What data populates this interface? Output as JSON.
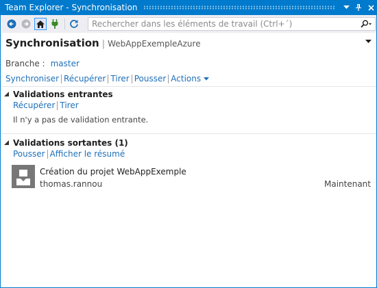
{
  "window": {
    "title": "Team Explorer - Synchronisation",
    "colors": {
      "accent": "#007acc",
      "link": "#1e6fb8",
      "toolbar": "#eeeef2",
      "avatar": "#777777"
    }
  },
  "toolbar": {
    "back_icon": "back-arrow-icon",
    "forward_icon": "forward-arrow-icon",
    "home_icon": "home-icon",
    "connect_icon": "plug-icon",
    "refresh_icon": "refresh-icon",
    "search": {
      "placeholder": "Rechercher dans les éléments de travail (Ctrl+´)"
    }
  },
  "header": {
    "title": "Synchronisation",
    "separator": "|",
    "repository": "WebAppExempleAzure"
  },
  "branch": {
    "label": "Branche :",
    "name": "master"
  },
  "actions": [
    {
      "label": "Synchroniser"
    },
    {
      "label": "Récupérer"
    },
    {
      "label": "Tirer"
    },
    {
      "label": "Pousser"
    },
    {
      "label": "Actions"
    }
  ],
  "incoming": {
    "title": "Validations entrantes",
    "links": [
      {
        "label": "Récupérer"
      },
      {
        "label": "Tirer"
      }
    ],
    "empty_text": "Il n'y a pas de validation entrante."
  },
  "outgoing": {
    "title": "Validations sortantes (1)",
    "links": [
      {
        "label": "Pousser"
      },
      {
        "label": "Afficher le résumé"
      }
    ],
    "commits": [
      {
        "message": "Création du projet WebAppExemple",
        "author": "thomas.rannou",
        "time": "Maintenant"
      }
    ]
  }
}
